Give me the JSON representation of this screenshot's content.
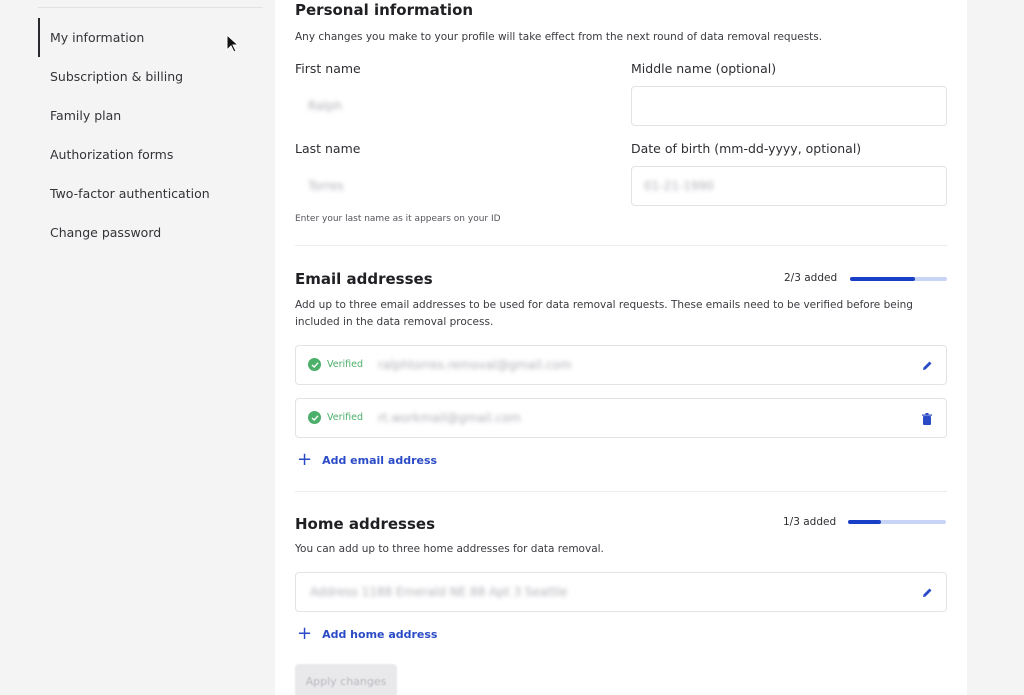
{
  "sidebar": {
    "items": [
      {
        "label": "My information",
        "active": true
      },
      {
        "label": "Subscription & billing"
      },
      {
        "label": "Family plan"
      },
      {
        "label": "Authorization forms"
      },
      {
        "label": "Two-factor authentication"
      },
      {
        "label": "Change password"
      }
    ]
  },
  "personal": {
    "title": "Personal information",
    "description": "Any changes you make to your profile will take effect from the next round of data removal requests.",
    "first_name_label": "First name",
    "first_name_value": "Ralph",
    "middle_name_label": "Middle name (optional)",
    "middle_name_value": "",
    "last_name_label": "Last name",
    "last_name_value": "Torres",
    "dob_label": "Date of birth (mm-dd-yyyy, optional)",
    "dob_value": "01-21-1990",
    "last_name_hint": "Enter your last name as it appears on your ID"
  },
  "emails": {
    "title": "Email addresses",
    "progress_label": "2/3 added",
    "progress_fraction": 0.667,
    "description": "Add up to three email addresses to be used for data removal requests. These emails need to be verified before being included in the data removal process.",
    "items": [
      {
        "status": "Verified",
        "value": "ralphtorres.removal@gmail.com"
      },
      {
        "status": "Verified",
        "value": "rt.workmail@gmail.com"
      }
    ],
    "add_label": "Add email address"
  },
  "homes": {
    "title": "Home addresses",
    "progress_label": "1/3 added",
    "progress_fraction": 0.333,
    "description": "You can add up to three home addresses for data removal.",
    "items": [
      {
        "value": "Address 1188 Emerald NE 88 Apt 3 Seattle"
      }
    ],
    "add_label": "Add home address"
  },
  "apply_label": "Apply changes",
  "colors": {
    "accent": "#1a3fc7",
    "verified": "#4caf6a"
  }
}
